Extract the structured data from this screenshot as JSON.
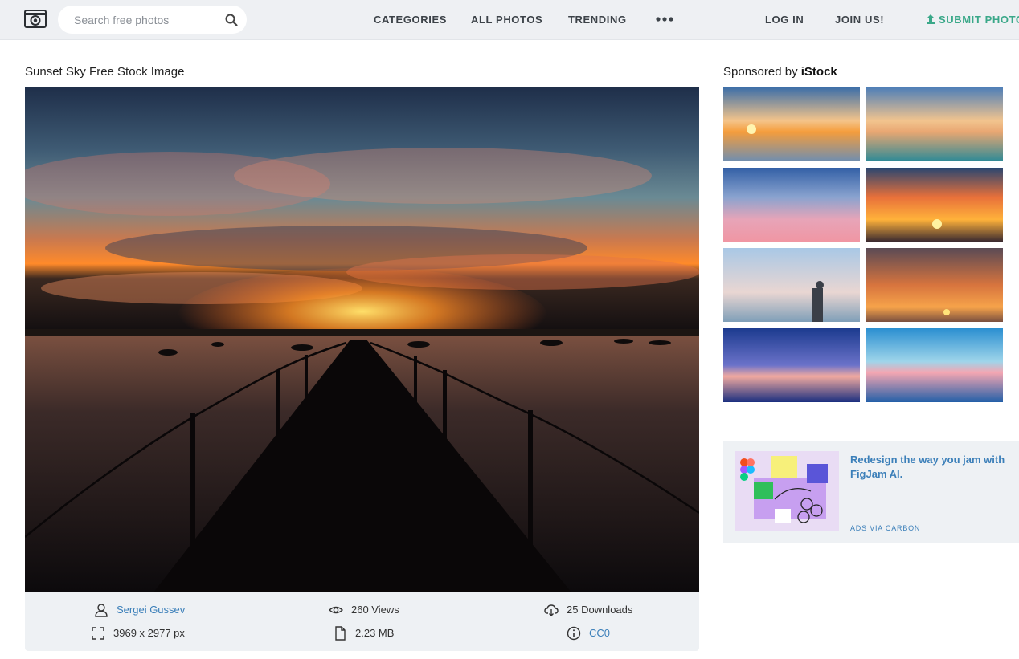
{
  "header": {
    "search_placeholder": "Search free photos",
    "nav": {
      "categories": "CATEGORIES",
      "all_photos": "ALL PHOTOS",
      "trending": "TRENDING",
      "log_in": "LOG IN",
      "join_us": "JOIN US!",
      "submit_photo": "SUBMIT PHOTO"
    }
  },
  "photo": {
    "title": "Sunset Sky Free Stock Image"
  },
  "meta": {
    "author": "Sergei Gussev",
    "views": "260 Views",
    "downloads": "25 Downloads",
    "dimensions": "3969 x 2977 px",
    "size": "2.23 MB",
    "license": "CC0"
  },
  "sidebar": {
    "sponsored_prefix": "Sponsored by ",
    "sponsored_brand": "iStock"
  },
  "ad": {
    "text": "Redesign the way you jam with FigJam AI.",
    "via": "ADS VIA CARBON"
  },
  "colors": {
    "accent_green": "#3aa889",
    "link_blue": "#3b7fb9",
    "header_bg": "#eef0f3"
  }
}
